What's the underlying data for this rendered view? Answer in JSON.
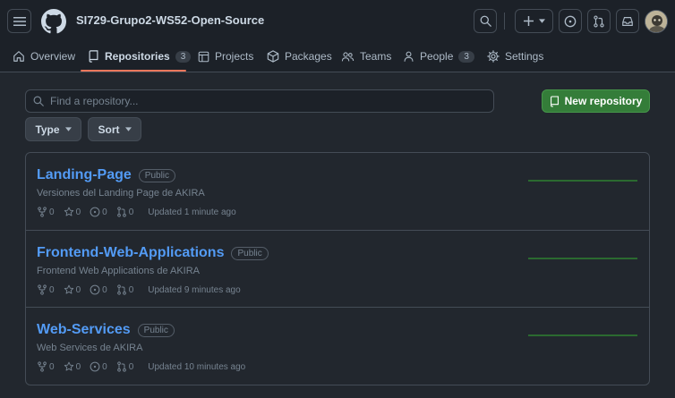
{
  "header": {
    "org_name": "SI729-Grupo2-WS52-Open-Source",
    "icons": [
      "hamburger-icon",
      "github-logo",
      "search-icon",
      "plus-icon",
      "caret-down-icon",
      "issue-icon",
      "pull-request-icon",
      "inbox-icon"
    ]
  },
  "tabs": [
    {
      "label": "Overview",
      "icon": "home-icon",
      "active": false
    },
    {
      "label": "Repositories",
      "icon": "repo-icon",
      "count": "3",
      "active": true
    },
    {
      "label": "Projects",
      "icon": "table-icon",
      "active": false
    },
    {
      "label": "Packages",
      "icon": "package-icon",
      "active": false
    },
    {
      "label": "Teams",
      "icon": "people-icon",
      "active": false
    },
    {
      "label": "People",
      "icon": "person-icon",
      "count": "3",
      "active": false
    },
    {
      "label": "Settings",
      "icon": "gear-icon",
      "active": false
    }
  ],
  "search": {
    "placeholder": "Find a repository..."
  },
  "new_repo_label": "New repository",
  "filters": {
    "type_label": "Type",
    "sort_label": "Sort"
  },
  "repos": [
    {
      "name": "Landing-Page",
      "visibility": "Public",
      "description": "Versiones del Landing Page de AKIRA",
      "forks": "0",
      "stars": "0",
      "issues": "0",
      "prs": "0",
      "updated": "Updated 1 minute ago"
    },
    {
      "name": "Frontend-Web-Applications",
      "visibility": "Public",
      "description": "Frontend Web Applications de AKIRA",
      "forks": "0",
      "stars": "0",
      "issues": "0",
      "prs": "0",
      "updated": "Updated 9 minutes ago"
    },
    {
      "name": "Web-Services",
      "visibility": "Public",
      "description": "Web Services de AKIRA",
      "forks": "0",
      "stars": "0",
      "issues": "0",
      "prs": "0",
      "updated": "Updated 10 minutes ago"
    }
  ],
  "colors": {
    "accent_link": "#539bf5",
    "primary_button": "#347d39",
    "active_tab_underline": "#ec775c",
    "background": "#22272e"
  }
}
